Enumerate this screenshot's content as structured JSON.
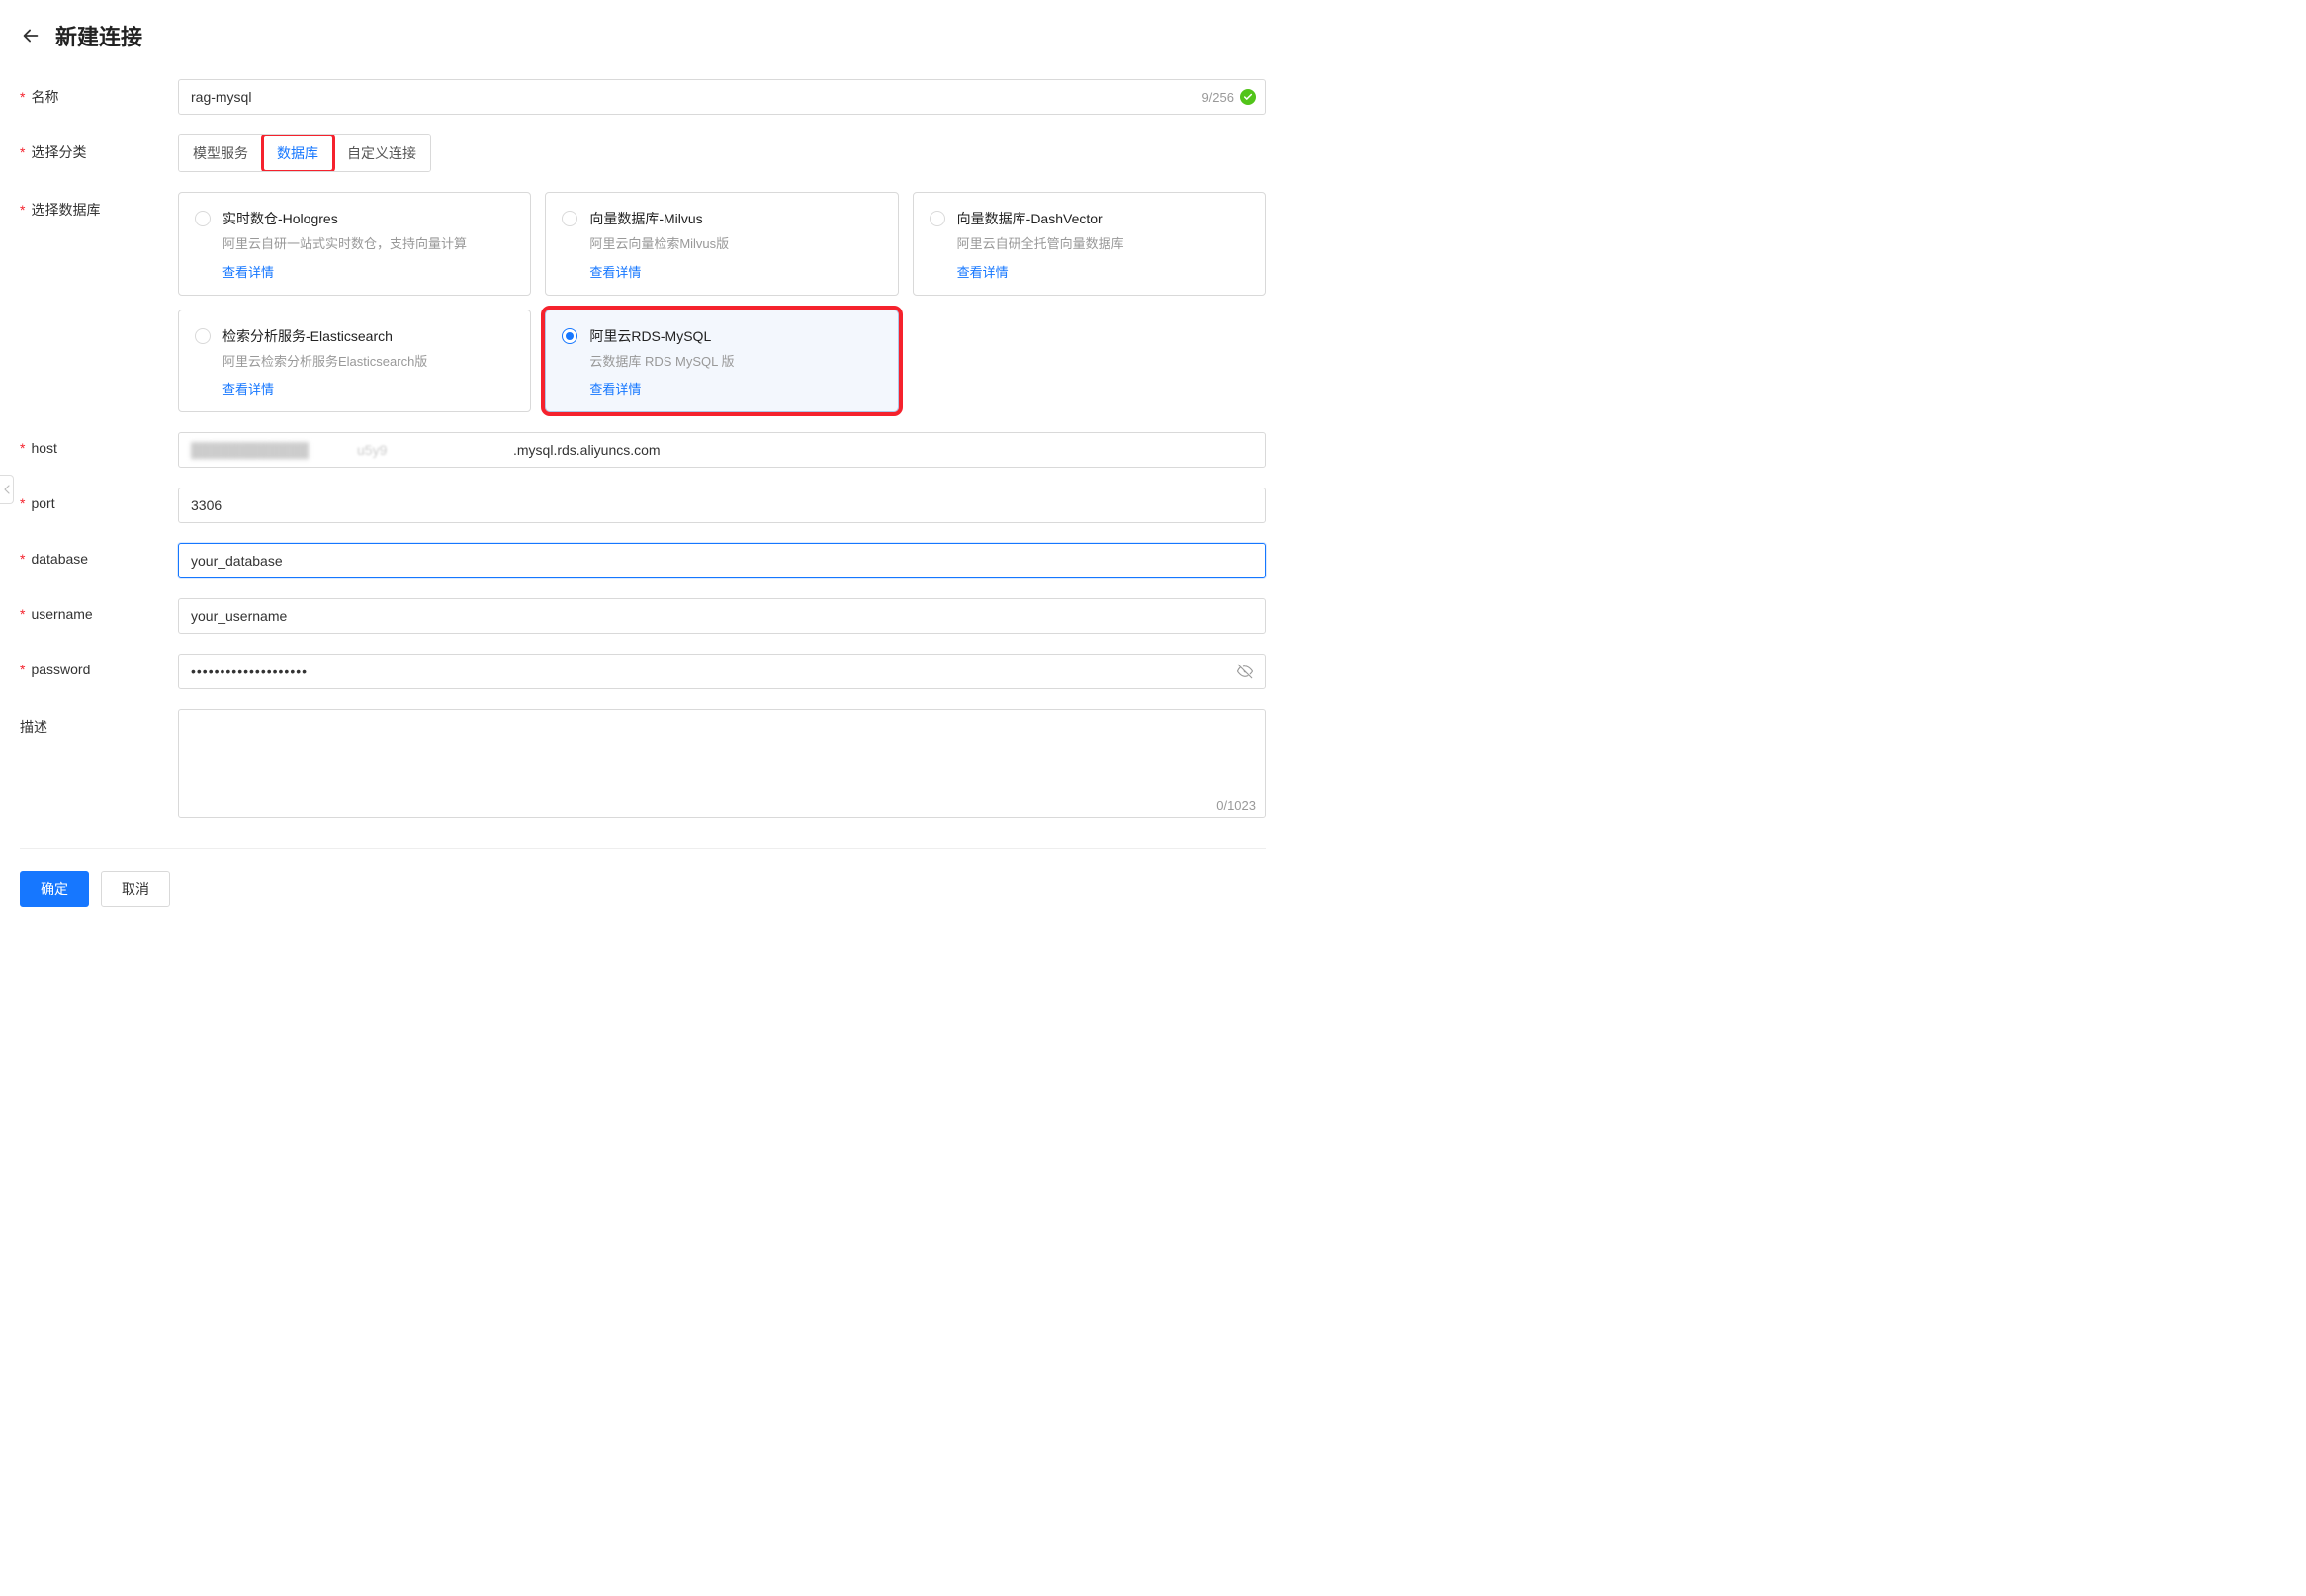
{
  "header": {
    "title": "新建连接"
  },
  "fields": {
    "name": {
      "label": "名称",
      "value": "rag-mysql",
      "counter": "9/256"
    },
    "category": {
      "label": "选择分类",
      "tabs": [
        "模型服务",
        "数据库",
        "自定义连接"
      ]
    },
    "database_select": {
      "label": "选择数据库",
      "options": [
        {
          "title": "实时数仓-Hologres",
          "desc": "阿里云自研一站式实时数仓，支持向量计算",
          "link": "查看详情"
        },
        {
          "title": "向量数据库-Milvus",
          "desc": "阿里云向量检索Milvus版",
          "link": "查看详情"
        },
        {
          "title": "向量数据库-DashVector",
          "desc": "阿里云自研全托管向量数据库",
          "link": "查看详情"
        },
        {
          "title": "检索分析服务-Elasticsearch",
          "desc": "阿里云检索分析服务Elasticsearch版",
          "link": "查看详情"
        },
        {
          "title": "阿里云RDS-MySQL",
          "desc": "云数据库 RDS MySQL 版",
          "link": "查看详情"
        }
      ]
    },
    "host": {
      "label": "host",
      "visible_suffix": ".mysql.rds.aliyuncs.com",
      "blur_mid": "u5y9"
    },
    "port": {
      "label": "port",
      "value": "3306"
    },
    "database": {
      "label": "database",
      "value": "your_database"
    },
    "username": {
      "label": "username",
      "value": "your_username"
    },
    "password": {
      "label": "password",
      "value": "••••••••••••••••••••"
    },
    "description": {
      "label": "描述",
      "counter": "0/1023"
    }
  },
  "footer": {
    "confirm": "确定",
    "cancel": "取消"
  }
}
